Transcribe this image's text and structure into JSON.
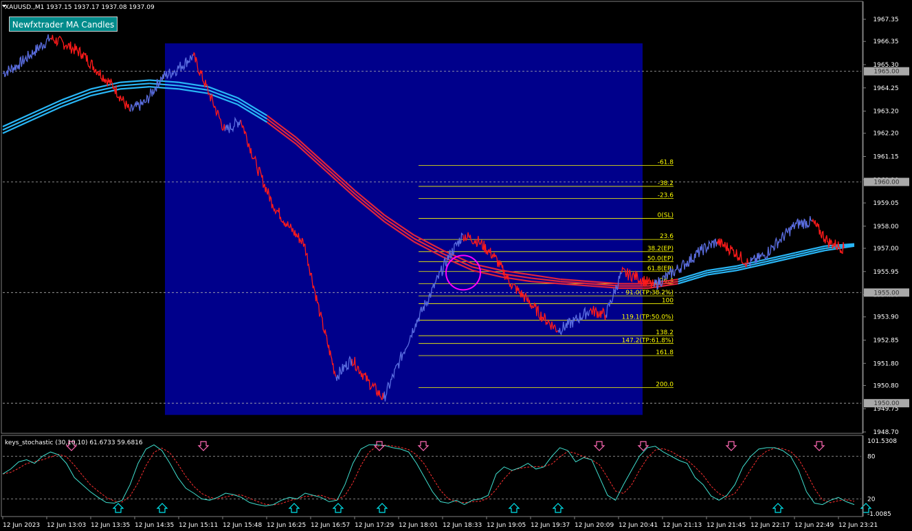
{
  "header": {
    "symbol_line": "XAUUSD.,M1  1937.15 1937.17 1937.08 1937.09",
    "indicator_button": "Newfxtrader MA Candles"
  },
  "subwindow": {
    "title": "keys_stochastic (30,10,10) 61.6733 59.6816"
  },
  "colors": {
    "background": "#000000",
    "zone": "#00008b",
    "bull": "#5b6ee1",
    "bear": "#ff1a1a",
    "ma_up": "#29b6f6",
    "ma_down": "#e0243c",
    "fib": "#ffff00",
    "stoch_main": "#40e0d0",
    "stoch_signal": "#ff3030",
    "arrow_down": "#ff69b4",
    "arrow_up": "#00e5ee",
    "circle": "#ff00ff"
  },
  "chart_data": [
    {
      "type": "line",
      "title": "XAUUSD.,M1",
      "y_ticks": [
        "1967.35",
        "1966.35",
        "1965.30",
        "1964.25",
        "1963.20",
        "1962.20",
        "1961.15",
        "1960.10",
        "1959.05",
        "1958.00",
        "1957.00",
        "1955.95",
        "1954.90",
        "1953.90",
        "1952.85",
        "1951.80",
        "1950.80",
        "1949.75",
        "1948.70"
      ],
      "price_levels": [
        "1965.00",
        "1960.00",
        "1955.00",
        "1950.00"
      ],
      "x_ticks": [
        "12 Jun 2023",
        "12 Jun 13:03",
        "12 Jun 13:35",
        "12 Jun 14:35",
        "12 Jun 15:11",
        "12 Jun 15:48",
        "12 Jun 16:25",
        "12 Jun 16:57",
        "12 Jun 17:29",
        "12 Jun 18:01",
        "12 Jun 18:33",
        "12 Jun 19:05",
        "12 Jun 19:37",
        "12 Jun 20:09",
        "12 Jun 20:41",
        "12 Jun 21:13",
        "12 Jun 21:45",
        "12 Jun 22:17",
        "12 Jun 22:49",
        "12 Jun 23:21"
      ],
      "ylim": [
        1948.7,
        1967.6
      ],
      "price": [
        1964.9,
        1965.3,
        1965.9,
        1966.5,
        1966.2,
        1965.8,
        1965.0,
        1964.3,
        1963.2,
        1963.6,
        1964.7,
        1965.1,
        1965.7,
        1964.0,
        1962.3,
        1962.8,
        1960.7,
        1959.0,
        1958.0,
        1957.2,
        1954.0,
        1951.2,
        1952.0,
        1951.0,
        1950.2,
        1951.9,
        1953.6,
        1955.0,
        1956.5,
        1957.6,
        1957.3,
        1956.6,
        1955.4,
        1954.7,
        1953.9,
        1953.3,
        1953.7,
        1954.2,
        1954.0,
        1955.9,
        1955.7,
        1955.3,
        1955.8,
        1956.3,
        1956.9,
        1957.3,
        1956.9,
        1956.3,
        1956.7,
        1957.4,
        1958.1,
        1958.2,
        1957.3,
        1957.0
      ],
      "ma_bands": [
        {
          "name": "",
          "values": [
            1962.2,
            1962.8,
            1963.4,
            1963.9,
            1964.2,
            1964.3,
            1964.2,
            1964.0,
            1963.5,
            1962.7,
            1961.7,
            1960.5,
            1959.3,
            1958.2,
            1957.3,
            1956.6,
            1956.0,
            1955.7,
            1955.5,
            1955.4,
            1955.3,
            1955.2,
            1955.2,
            1955.4,
            1955.8,
            1956.0,
            1956.3,
            1956.6,
            1956.9,
            1957.1
          ]
        },
        {
          "name": "",
          "values": [
            1962.5,
            1963.1,
            1963.7,
            1964.2,
            1964.5,
            1964.6,
            1964.5,
            1964.3,
            1963.8,
            1963.0,
            1962.0,
            1960.8,
            1959.6,
            1958.5,
            1957.6,
            1956.9,
            1956.3,
            1956.0,
            1955.8,
            1955.6,
            1955.5,
            1955.4,
            1955.4,
            1955.6,
            1956.0,
            1956.2,
            1956.5,
            1956.8,
            1957.1,
            1957.2
          ]
        }
      ],
      "zone": {
        "x_from": "12 Jun 14:35",
        "x_to": "12 Jun 20:41",
        "y_top": 1966.2,
        "y_bottom": 1949.5
      },
      "fibonacci": {
        "x_from": "12 Jun 18:01",
        "x_to": "12 Jun 20:41",
        "levels": [
          {
            "label": "-61.8",
            "price": 1960.75
          },
          {
            "label": "-38.2",
            "price": 1959.8
          },
          {
            "label": "-23.6",
            "price": 1959.25
          },
          {
            "label": "0(SL)",
            "price": 1958.35
          },
          {
            "label": "23.6",
            "price": 1957.4
          },
          {
            "label": "38.2(EP)",
            "price": 1956.85
          },
          {
            "label": "50.0(EP)",
            "price": 1956.4
          },
          {
            "label": "61.8(EP)",
            "price": 1955.95
          },
          {
            "label": "76.4",
            "price": 1955.4
          },
          {
            "label": "91.0(TP:38.2%)",
            "price": 1954.85
          },
          {
            "label": "100",
            "price": 1954.5
          },
          {
            "label": "119.1(TP:50.0%)",
            "price": 1953.75
          },
          {
            "label": "138.2",
            "price": 1953.05
          },
          {
            "label": "147.2(TP:61.8%)",
            "price": 1952.7
          },
          {
            "label": "161.8",
            "price": 1952.15
          },
          {
            "label": "200.0",
            "price": 1950.7
          }
        ]
      },
      "circle_marker": {
        "x": "12 Jun 18:33",
        "price": 1955.9
      }
    },
    {
      "type": "line",
      "title": "keys_stochastic (30,10,10)",
      "y_ticks": [
        "101.5308",
        "80",
        "20",
        "-1.0085"
      ],
      "ylim": [
        -1.0085,
        101.5308
      ],
      "series": [
        {
          "name": "",
          "values": [
            55,
            62,
            72,
            75,
            70,
            80,
            86,
            82,
            70,
            50,
            40,
            30,
            22,
            15,
            14,
            18,
            40,
            70,
            90,
            96,
            88,
            70,
            50,
            35,
            28,
            20,
            18,
            22,
            28,
            26,
            22,
            15,
            12,
            10,
            12,
            18,
            22,
            20,
            28,
            25,
            22,
            16,
            18,
            40,
            70,
            90,
            96,
            96,
            95,
            92,
            90,
            86,
            70,
            50,
            30,
            16,
            14,
            18,
            12,
            18,
            20,
            25,
            55,
            65,
            60,
            64,
            70,
            62,
            65,
            80,
            92,
            88,
            72,
            78,
            75,
            50,
            25,
            18,
            40,
            60,
            80,
            92,
            94,
            86,
            80,
            74,
            70,
            50,
            40,
            24,
            18,
            25,
            40,
            65,
            80,
            90,
            92,
            92,
            88,
            80,
            60,
            30,
            14,
            12,
            18,
            22,
            16,
            12
          ]
        }
      ],
      "down_arrows": [
        "12 Jun 13:03",
        "12 Jun 15:11",
        "12 Jun 17:29",
        "12 Jun 18:01",
        "12 Jun 20:09",
        "12 Jun 20:41",
        "12 Jun 21:45",
        "12 Jun 22:49"
      ],
      "up_arrows": [
        "12 Jun 13:35",
        "12 Jun 14:35",
        "12 Jun 16:25",
        "12 Jun 16:57",
        "12 Jun 17:29",
        "12 Jun 19:05",
        "12 Jun 19:37",
        "12 Jun 22:17",
        "12 Jun 23:21"
      ]
    }
  ]
}
